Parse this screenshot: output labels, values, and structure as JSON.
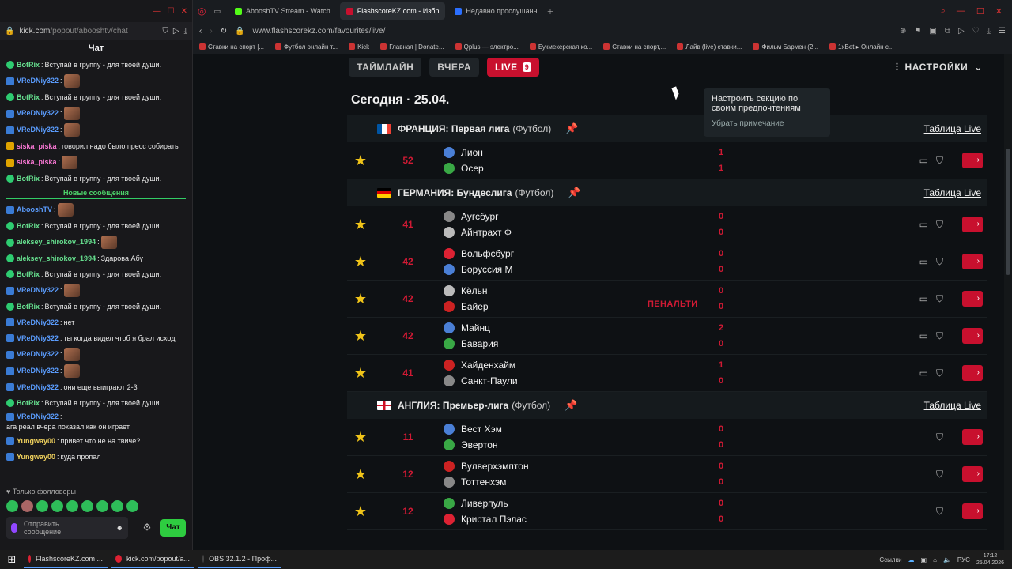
{
  "chat_window": {
    "url_domain": "kick.com",
    "url_path": "/popout/abooshtv/chat",
    "title": "Чат",
    "messages": [
      {
        "user": "BotRix",
        "color": "green",
        "text": "Вступай в группу - для твоей души."
      },
      {
        "user": "VReDNiy322",
        "color": "blue",
        "text": ""
      },
      {
        "user": "BotRix",
        "color": "green",
        "text": "Вступай в группу - для твоей души."
      },
      {
        "user": "VReDNiy322",
        "color": "blue",
        "text": ""
      },
      {
        "user": "VReDNiy322",
        "color": "blue",
        "text": ""
      },
      {
        "user": "siska_piska",
        "color": "pink",
        "text": "говорил надо было пресс собирать"
      },
      {
        "user": "siska_piska",
        "color": "pink",
        "text": ""
      },
      {
        "user": "BotRix",
        "color": "green",
        "text": "Вступай в группу - для твоей души."
      }
    ],
    "new_messages_label": "Новые сообщения",
    "messages2": [
      {
        "user": "AbooshTV",
        "color": "blue",
        "text": ""
      },
      {
        "user": "BotRix",
        "color": "green",
        "text": "Вступай в группу - для твоей души."
      },
      {
        "user": "aleksey_shirokov_1994",
        "color": "green",
        "text": ""
      },
      {
        "user": "aleksey_shirokov_1994",
        "color": "green",
        "text": "Здарова Абу"
      },
      {
        "user": "BotRix",
        "color": "green",
        "text": "Вступай в группу - для твоей души."
      },
      {
        "user": "VReDNiy322",
        "color": "blue",
        "text": ""
      },
      {
        "user": "BotRix",
        "color": "green",
        "text": "Вступай в группу - для твоей души."
      },
      {
        "user": "VReDNiy322",
        "color": "blue",
        "text": "нет"
      },
      {
        "user": "VReDNiy322",
        "color": "blue",
        "text": "ты когда видел чтоб я брал исход"
      },
      {
        "user": "VReDNiy322",
        "color": "blue",
        "text": ""
      },
      {
        "user": "VReDNiy322",
        "color": "blue",
        "text": ""
      },
      {
        "user": "VReDNiy322",
        "color": "blue",
        "text": "они еще выиграют 2-3"
      },
      {
        "user": "BotRix",
        "color": "green",
        "text": "Вступай в группу - для твоей души."
      },
      {
        "user": "VReDNiy322",
        "color": "blue",
        "text": "ага реал вчера показал как он играет"
      },
      {
        "user": "Yungway00",
        "color": "yellow",
        "text": "привет что не на твиче?"
      },
      {
        "user": "Yungway00",
        "color": "yellow",
        "text": "куда пропал"
      }
    ],
    "followers_only": "Только фолловеры",
    "input_placeholder": "Отправить сообщение",
    "send_label": "Чат"
  },
  "browser": {
    "tabs": [
      {
        "label": "AbooshTV Stream - Watch",
        "color": "#53fc18"
      },
      {
        "label": "FlashscoreKZ.com - Избр",
        "color": "#c8102e"
      },
      {
        "label": "Недавно прослушанн",
        "color": "#2b6fff"
      }
    ],
    "url": "www.flashscorekz.com/favourites/live/",
    "bookmarks": [
      "Ставки на спорт |...",
      "Футбол онлайн т...",
      "Kick",
      "Главная | Donate...",
      "Qplus — электро...",
      "Букмекерская ко...",
      "Ставки на спорт,...",
      "Лайв (live) ставки...",
      "Фильм Бармен (2...",
      "1xBet ▸ Онлайн с..."
    ]
  },
  "flashscore": {
    "filters": {
      "timeline": "ТАЙМЛАЙН",
      "yesterday": "ВЧЕРА",
      "live": "LIVE",
      "live_count": "9"
    },
    "settings_label": "НАСТРОЙКИ",
    "tooltip": {
      "text": "Настроить секцию по своим предпочтениям",
      "remove": "Убрать примечание"
    },
    "date": "Сегодня · 25.04.",
    "table_link": "Таблица Live",
    "leagues": [
      {
        "country": "ФРАНЦИЯ: Первая лига",
        "sport": "(Футбол)",
        "flag": "fr",
        "matches": [
          {
            "minute": "52",
            "home": "Лион",
            "away": "Осер",
            "home_score": "1",
            "away_score": "1",
            "note": "",
            "icons": 2
          }
        ]
      },
      {
        "country": "ГЕРМАНИЯ: Бундеслига",
        "sport": "(Футбол)",
        "flag": "de",
        "matches": [
          {
            "minute": "41",
            "home": "Аугсбург",
            "away": "Айнтрахт Ф",
            "home_score": "0",
            "away_score": "0",
            "note": "",
            "icons": 2
          },
          {
            "minute": "42",
            "home": "Вольфсбург",
            "away": "Боруссия М",
            "home_score": "0",
            "away_score": "0",
            "note": "",
            "icons": 2
          },
          {
            "minute": "42",
            "home": "Кёльн",
            "away": "Байер",
            "home_score": "0",
            "away_score": "0",
            "note": "ПЕНАЛЬТИ",
            "icons": 2
          },
          {
            "minute": "42",
            "home": "Майнц",
            "away": "Бавария",
            "home_score": "2",
            "away_score": "0",
            "note": "",
            "icons": 2
          },
          {
            "minute": "41",
            "home": "Хайденхайм",
            "away": "Санкт-Паули",
            "home_score": "1",
            "away_score": "0",
            "note": "",
            "icons": 2
          }
        ]
      },
      {
        "country": "АНГЛИЯ: Премьер-лига",
        "sport": "(Футбол)",
        "flag": "en",
        "matches": [
          {
            "minute": "11",
            "home": "Вест Хэм",
            "away": "Эвертон",
            "home_score": "0",
            "away_score": "0",
            "note": "",
            "icons": 1
          },
          {
            "minute": "12",
            "home": "Вулверхэмптон",
            "away": "Тоттенхэм",
            "home_score": "0",
            "away_score": "0",
            "note": "",
            "icons": 1
          },
          {
            "minute": "12",
            "home": "Ливерпуль",
            "away": "Кристал Пэлас",
            "home_score": "0",
            "away_score": "0",
            "note": "",
            "icons": 1
          }
        ]
      }
    ]
  },
  "taskbar": {
    "items": [
      "FlashscoreKZ.com ...",
      "kick.com/popout/a...",
      "OBS 32.1.2 - Проф..."
    ],
    "links_label": "Ссылки",
    "lang": "РУС",
    "time": "17:12",
    "date": "25.04.2026"
  }
}
